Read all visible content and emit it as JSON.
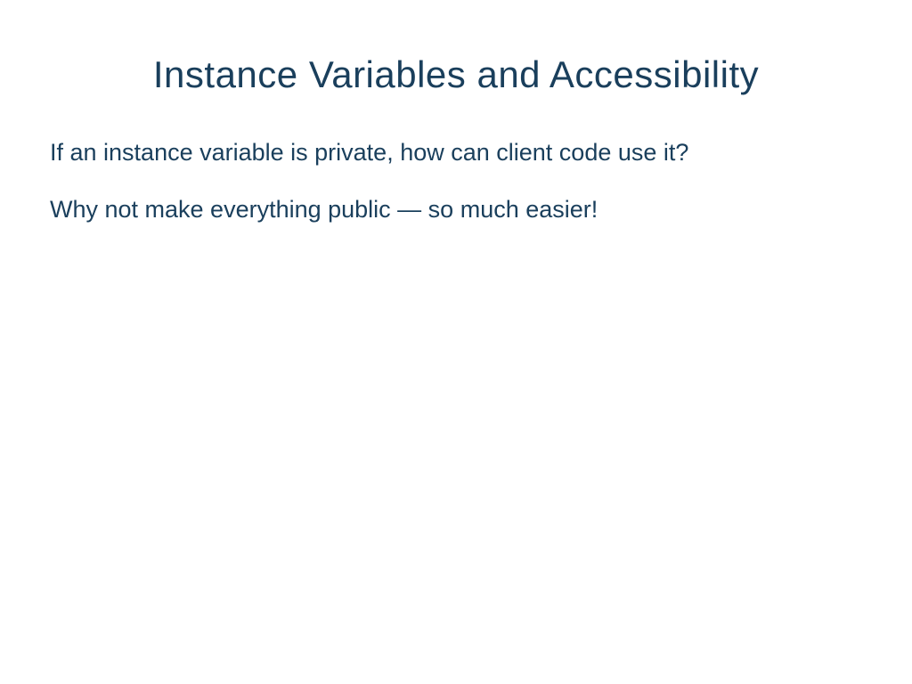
{
  "slide": {
    "title": "Instance Variables and Accessibility",
    "paragraphs": [
      "If an instance variable is private, how can client code use it?",
      "Why not make everything public — so much easier!"
    ]
  }
}
